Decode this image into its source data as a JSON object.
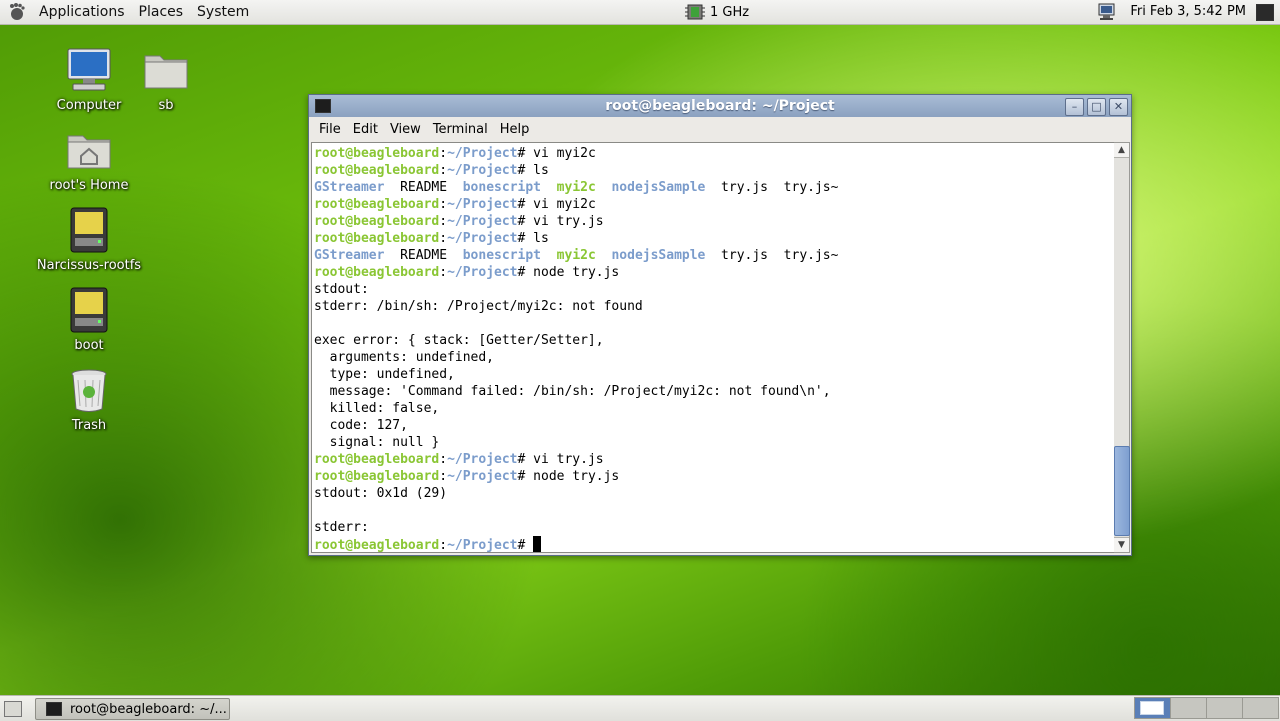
{
  "top_panel": {
    "menus": [
      "Applications",
      "Places",
      "System"
    ],
    "cpu_freq": "1 GHz",
    "clock": "Fri Feb  3,  5:42 PM"
  },
  "desktop_icons": [
    {
      "label": "Computer",
      "icon": "computer-icon"
    },
    {
      "label": "sb",
      "icon": "folder-icon"
    },
    {
      "label": "root's Home",
      "icon": "home-folder-icon"
    },
    {
      "label": "Narcissus-rootfs",
      "icon": "drive-icon"
    },
    {
      "label": "boot",
      "icon": "drive-icon"
    },
    {
      "label": "Trash",
      "icon": "trash-icon"
    }
  ],
  "window": {
    "title": "root@beagleboard: ~/Project",
    "menu": [
      "File",
      "Edit",
      "View",
      "Terminal",
      "Help"
    ],
    "buttons": {
      "minimize": "–",
      "maximize": "□",
      "close": "✕"
    }
  },
  "terminal": {
    "user": "root@beagleboard",
    "cwd": "~/Project",
    "colors": {
      "prompt": "#8ac634",
      "dir": "#7b9ccb"
    },
    "lines": [
      {
        "type": "prompt",
        "cmd": "vi myi2c"
      },
      {
        "type": "prompt",
        "cmd": "ls"
      },
      {
        "type": "ls",
        "entries": [
          "GStreamer",
          "README",
          "bonescript",
          "myi2c",
          "nodejsSample",
          "try.js",
          "try.js~"
        ]
      },
      {
        "type": "prompt",
        "cmd": "vi myi2c"
      },
      {
        "type": "prompt",
        "cmd": "vi try.js"
      },
      {
        "type": "prompt",
        "cmd": "ls"
      },
      {
        "type": "ls",
        "entries": [
          "GStreamer",
          "README",
          "bonescript",
          "myi2c",
          "nodejsSample",
          "try.js",
          "try.js~"
        ]
      },
      {
        "type": "prompt",
        "cmd": "node try.js"
      },
      {
        "type": "out",
        "text": "stdout:"
      },
      {
        "type": "out",
        "text": "stderr: /bin/sh: /Project/myi2c: not found"
      },
      {
        "type": "out",
        "text": ""
      },
      {
        "type": "out",
        "text": "exec error: { stack: [Getter/Setter],"
      },
      {
        "type": "out",
        "text": "  arguments: undefined,"
      },
      {
        "type": "out",
        "text": "  type: undefined,"
      },
      {
        "type": "out",
        "text": "  message: 'Command failed: /bin/sh: /Project/myi2c: not found\\n',"
      },
      {
        "type": "out",
        "text": "  killed: false,"
      },
      {
        "type": "out",
        "text": "  code: 127,"
      },
      {
        "type": "out",
        "text": "  signal: null }"
      },
      {
        "type": "prompt",
        "cmd": "vi try.js"
      },
      {
        "type": "prompt",
        "cmd": "node try.js"
      },
      {
        "type": "out",
        "text": "stdout: 0x1d (29)"
      },
      {
        "type": "out",
        "text": ""
      },
      {
        "type": "out",
        "text": "stderr:"
      },
      {
        "type": "prompt",
        "cmd": "",
        "cursor": true
      }
    ]
  },
  "taskbar": {
    "task_label": "root@beagleboard: ~/..."
  },
  "workspaces": {
    "count": 4,
    "active": 1
  }
}
